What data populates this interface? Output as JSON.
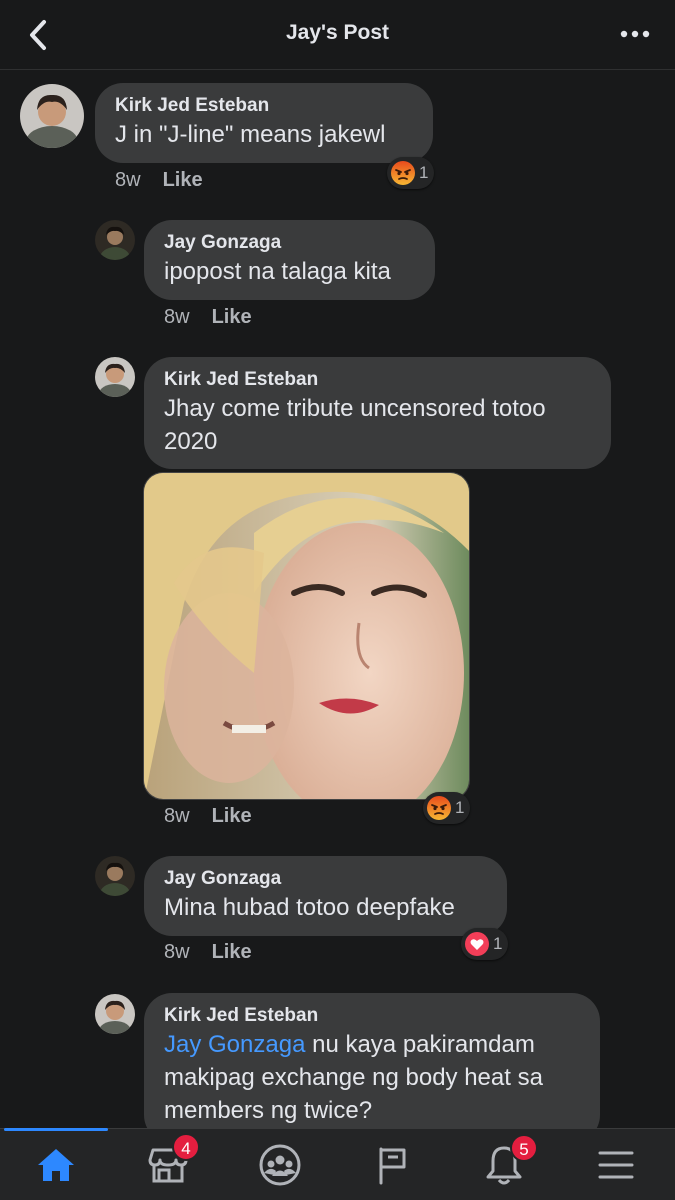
{
  "header": {
    "title": "Jay's Post"
  },
  "comments": [
    {
      "name": "Kirk Jed Esteban",
      "text": "J in \"J-line\" means jakewl",
      "time": "8w",
      "like_label": "Like",
      "reaction_count": "1"
    },
    {
      "name": "Jay Gonzaga",
      "text": "ipopost na talaga kita",
      "time": "8w",
      "like_label": "Like"
    },
    {
      "name": "Kirk Jed Esteban",
      "text_line1": "Jhay come tribute uncensored totoo",
      "text_line2": "2020",
      "time": "8w",
      "like_label": "Like",
      "reaction_count": "1"
    },
    {
      "name": "Jay Gonzaga",
      "text": "Mina hubad totoo deepfake",
      "time": "8w",
      "like_label": "Like",
      "reaction_count": "1"
    },
    {
      "name": "Kirk Jed Esteban",
      "mention": "Jay Gonzaga",
      "text_line1": " nu kaya pakiramdam",
      "text_line2": "makipag exchange ng body heat sa",
      "text_line3": "members ng twice?"
    }
  ],
  "tabbar": {
    "items": [
      {
        "icon": "home-icon"
      },
      {
        "icon": "marketplace-icon",
        "badge": "4"
      },
      {
        "icon": "groups-icon"
      },
      {
        "icon": "pages-flag-icon"
      },
      {
        "icon": "notifications-bell-icon",
        "badge": "5"
      },
      {
        "icon": "menu-icon"
      }
    ]
  },
  "colors": {
    "background": "#18191a",
    "bubble": "#3a3b3c",
    "accent": "#2d88ff",
    "mention": "#4599ff",
    "badge": "#e41e3f"
  }
}
